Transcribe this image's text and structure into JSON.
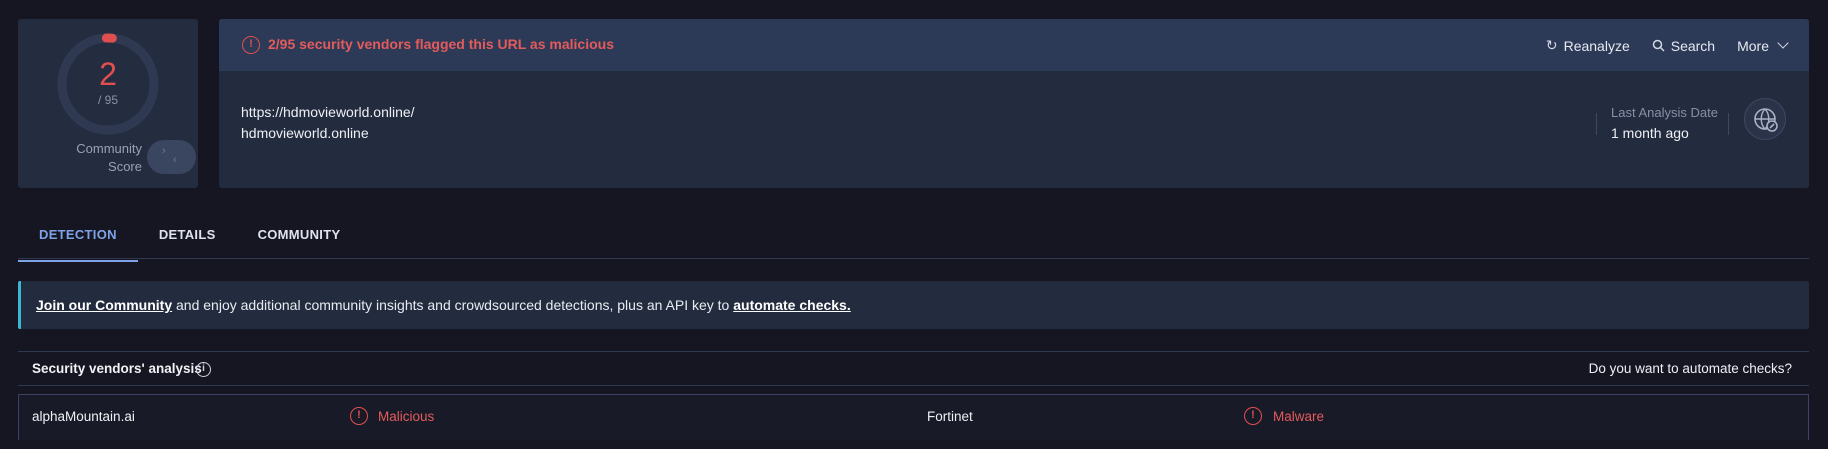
{
  "score": {
    "detections": "2",
    "total": "/ 95",
    "community_label_line1": "Community",
    "community_label_line2": "Score",
    "ring_fraction": 0.021,
    "ring_color": "#e04f4f"
  },
  "alert": {
    "icon": "alert-circle-icon",
    "text": "2/95 security vendors flagged this URL as malicious"
  },
  "actions": {
    "reanalyze": "Reanalyze",
    "search": "Search",
    "more": "More"
  },
  "target": {
    "url": "https://hdmovieworld.online/",
    "domain": "hdmovieworld.online"
  },
  "analysis": {
    "last_label": "Last Analysis Date",
    "last_value": "1 month ago"
  },
  "tabs": [
    {
      "label": "DETECTION",
      "active": true
    },
    {
      "label": "DETAILS",
      "active": false
    },
    {
      "label": "COMMUNITY",
      "active": false
    }
  ],
  "banner": {
    "join_link": "Join our Community",
    "middle_text": " and enjoy additional community insights and crowdsourced detections, plus an API key to ",
    "automate_link": "automate checks."
  },
  "vendors": {
    "title": "Security vendors' analysis",
    "automate_question": "Do you want to automate checks?",
    "rows": [
      {
        "left_vendor": "alphaMountain.ai",
        "left_verdict": "Malicious",
        "right_vendor": "Fortinet",
        "right_verdict": "Malware"
      }
    ]
  },
  "colors": {
    "accent": "#7ea2e6",
    "malicious": "#e04f4f",
    "banner_stripe": "#3fb6d1"
  }
}
